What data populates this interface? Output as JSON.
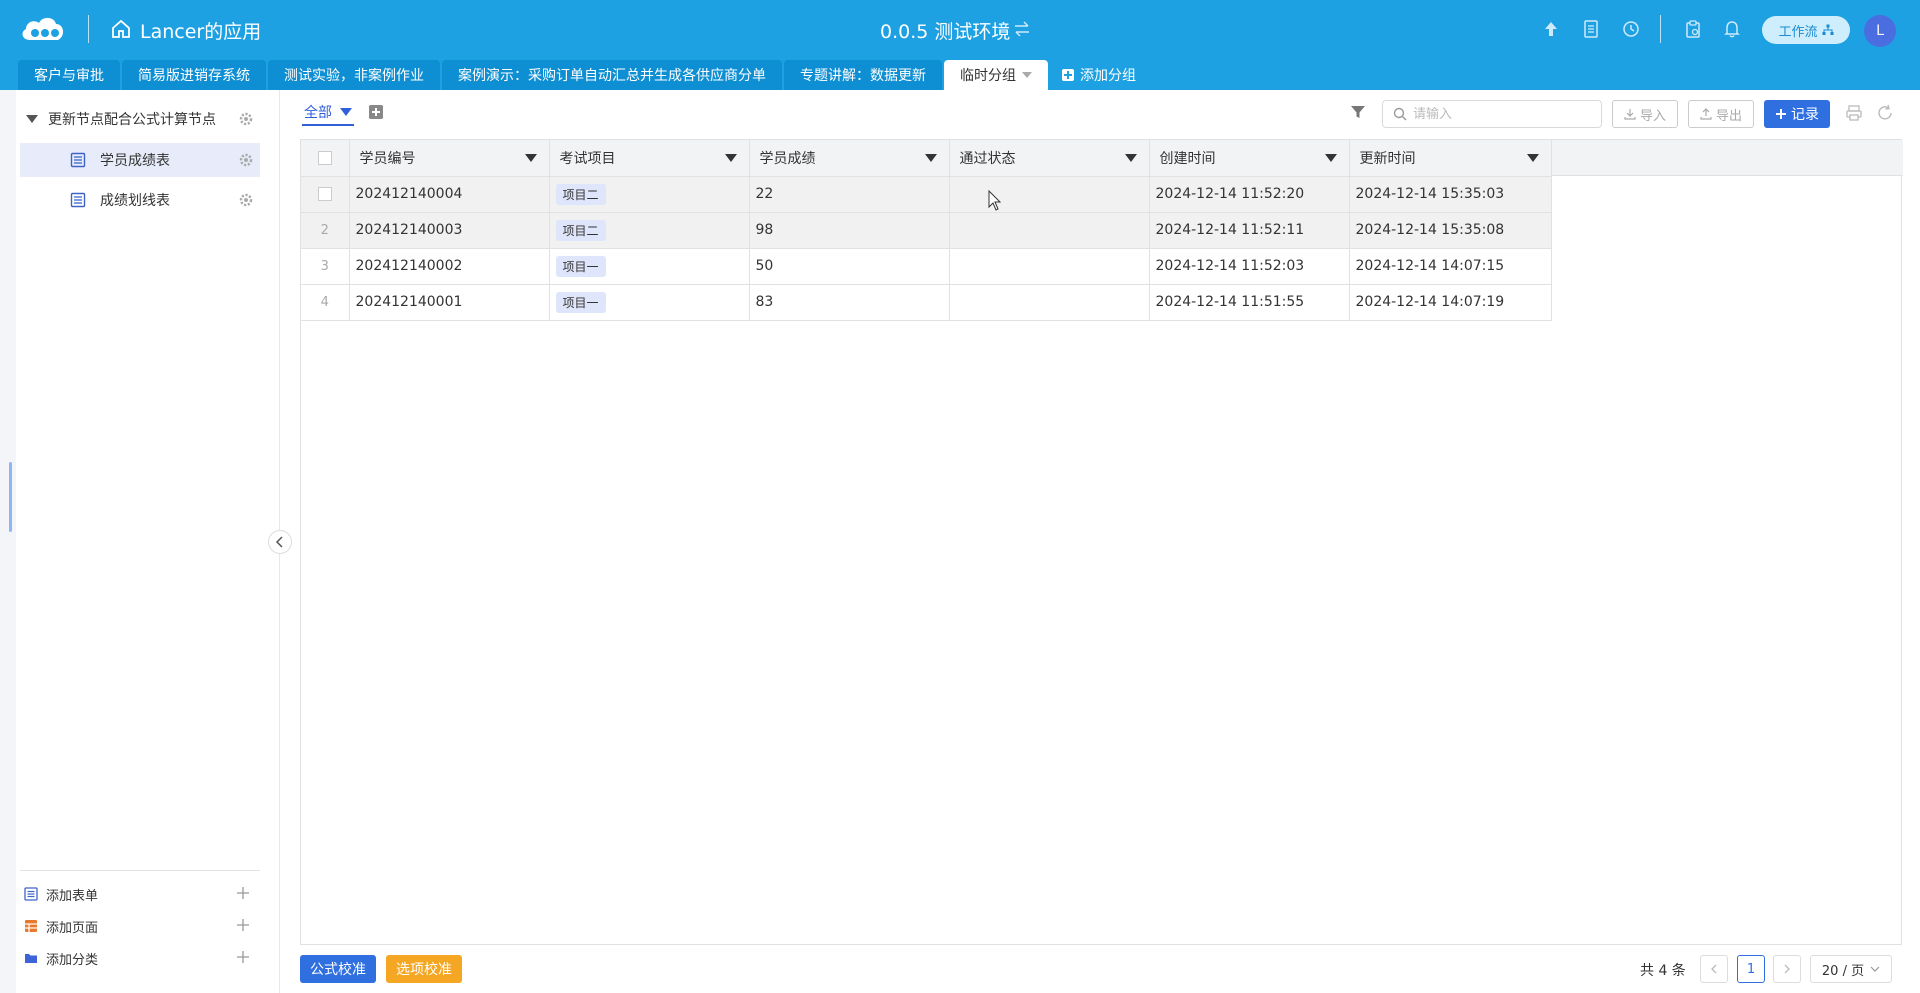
{
  "topbar": {
    "app_title": "Lancer的应用",
    "env_title": "0.0.5 测试环境",
    "workflow_label": "工作流",
    "avatar_letter": "L"
  },
  "tabs": [
    {
      "label": "客户与审批"
    },
    {
      "label": "简易版进销存系统"
    },
    {
      "label": "测试实验，非案例作业"
    },
    {
      "label": "案例演示：采购订单自动汇总并生成各供应商分单"
    },
    {
      "label": "专题讲解：数据更新"
    },
    {
      "label": "临时分组"
    }
  ],
  "tab_add_label": "添加分组",
  "sidebar": {
    "group_label": "更新节点配合公式计算节点",
    "items": [
      {
        "label": "学员成绩表"
      },
      {
        "label": "成绩划线表"
      }
    ],
    "bottom": [
      {
        "label": "添加表单"
      },
      {
        "label": "添加页面"
      },
      {
        "label": "添加分类"
      }
    ]
  },
  "toolbar": {
    "view_label": "全部",
    "search_placeholder": "请输入",
    "import_label": "导入",
    "export_label": "导出",
    "record_label": "记录"
  },
  "table": {
    "columns": [
      "学员编号",
      "考试项目",
      "学员成绩",
      "通过状态",
      "创建时间",
      "更新时间"
    ],
    "rows": [
      {
        "index": "",
        "id": "202412140004",
        "project": "项目二",
        "score": "22",
        "status": "",
        "created": "2024-12-14 11:52:20",
        "updated": "2024-12-14 15:35:03"
      },
      {
        "index": "2",
        "id": "202412140003",
        "project": "项目二",
        "score": "98",
        "status": "",
        "created": "2024-12-14 11:52:11",
        "updated": "2024-12-14 15:35:08"
      },
      {
        "index": "3",
        "id": "202412140002",
        "project": "项目一",
        "score": "50",
        "status": "",
        "created": "2024-12-14 11:52:03",
        "updated": "2024-12-14 14:07:15"
      },
      {
        "index": "4",
        "id": "202412140001",
        "project": "项目一",
        "score": "83",
        "status": "",
        "created": "2024-12-14 11:51:55",
        "updated": "2024-12-14 14:07:19"
      }
    ]
  },
  "footer": {
    "formula_label": "公式校准",
    "option_label": "选项校准",
    "total_label": "共 4 条",
    "current_page": "1",
    "page_size": "20 / 页"
  },
  "colors": {
    "topbar": "#1da1e3",
    "primary": "#2f6fe0",
    "warning": "#f5a623"
  }
}
